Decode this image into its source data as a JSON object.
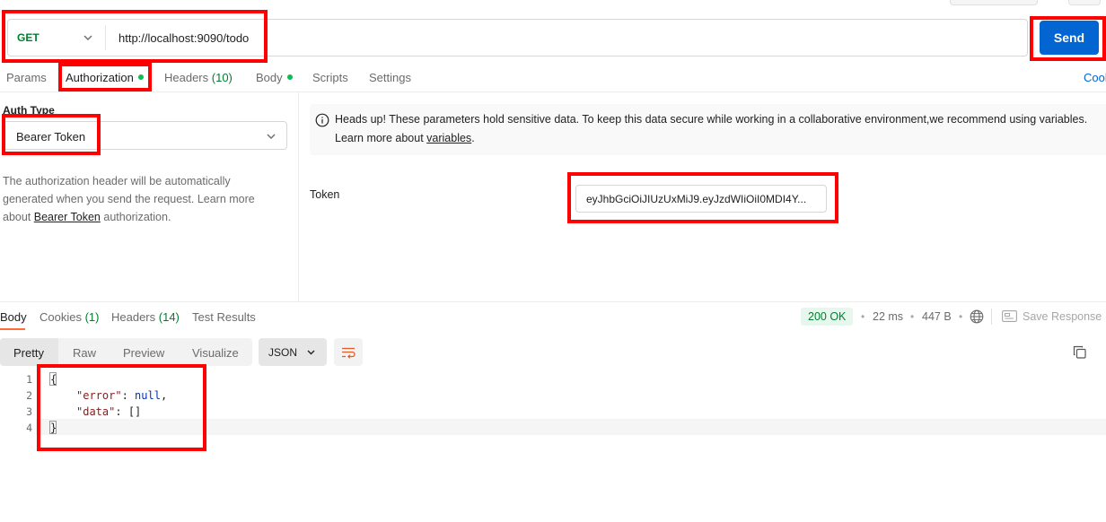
{
  "request": {
    "method": "GET",
    "url": "http://localhost:9090/todo",
    "send_label": "Send"
  },
  "request_tabs": [
    {
      "label": "Params",
      "count": "",
      "dot": false,
      "active": false
    },
    {
      "label": "Authorization",
      "count": "",
      "dot": true,
      "active": true
    },
    {
      "label": "Headers",
      "count": "(10)",
      "dot": false,
      "active": false
    },
    {
      "label": "Body",
      "count": "",
      "dot": true,
      "active": false
    },
    {
      "label": "Scripts",
      "count": "",
      "dot": false,
      "active": false
    },
    {
      "label": "Settings",
      "count": "",
      "dot": false,
      "active": false
    }
  ],
  "cookies_link": "Cool",
  "auth": {
    "type_label": "Auth Type",
    "type_value": "Bearer Token",
    "desc_before": "The authorization header will be automatically generated when you send the request. Learn more about ",
    "desc_link": "Bearer Token",
    "desc_after": " authorization.",
    "notice_before": "Heads up! These parameters hold sensitive data. To keep this data secure while working in a collaborative environment,we recommend using variables. Learn more about ",
    "notice_link": "variables",
    "notice_after": ".",
    "token_label": "Token",
    "token_value": "eyJhbGciOiJIUzUxMiJ9.eyJzdWIiOiI0MDI4Y..."
  },
  "response": {
    "tabs": [
      {
        "label": "Body",
        "count": "",
        "active": true
      },
      {
        "label": "Cookies",
        "count": "(1)",
        "active": false
      },
      {
        "label": "Headers",
        "count": "(14)",
        "active": false
      },
      {
        "label": "Test Results",
        "count": "",
        "active": false
      }
    ],
    "status": "200 OK",
    "time": "22 ms",
    "size": "447 B",
    "save_label": "Save Response",
    "formats": [
      "Pretty",
      "Raw",
      "Preview",
      "Visualize"
    ],
    "language": "JSON",
    "line_numbers": [
      "1",
      "2",
      "3",
      "4"
    ],
    "code": {
      "open": "{",
      "error_key": "\"error\"",
      "error_sep": ": ",
      "error_val": "null",
      "error_end": ",",
      "data_key": "\"data\"",
      "data_sep": ": ",
      "data_val": "[]",
      "close": "}"
    }
  },
  "colors": {
    "accent_send": "#0265d2",
    "method_get": "#007f31",
    "highlight": "#ff0000",
    "tab_underline": "#ff6c37"
  }
}
